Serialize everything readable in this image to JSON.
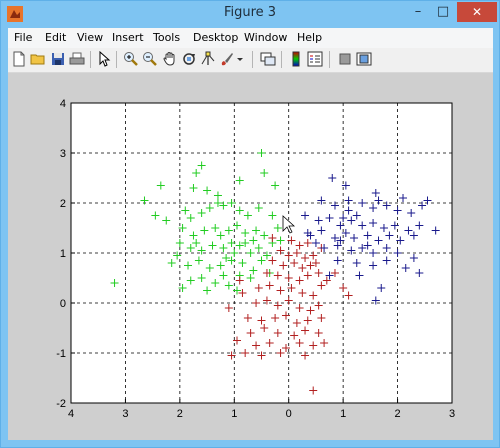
{
  "window": {
    "title": "Figure 3",
    "min_glyph": "–",
    "max_glyph": "□",
    "close_glyph": "✕"
  },
  "menu": [
    "File",
    "Edit",
    "View",
    "Insert",
    "Tools",
    "Desktop",
    "Window",
    "Help"
  ],
  "toolbar": {
    "icons": [
      "new-figure-icon",
      "open-file-icon",
      "save-icon",
      "print-icon",
      "edit-plot-arrow-icon",
      "zoom-in-icon",
      "zoom-out-icon",
      "pan-hand-icon",
      "rotate-3d-icon",
      "data-cursor-icon",
      "brush-icon",
      "brush-dropdown-icon",
      "link-plot-icon",
      "insert-colorbar-icon",
      "insert-legend-icon",
      "hide-plot-tools-icon",
      "show-plot-tools-icon"
    ]
  },
  "chart_data": {
    "type": "scatter",
    "marker": "+",
    "x_range": [
      -4,
      3
    ],
    "y_range": [
      -2,
      4
    ],
    "x_ticks": [
      -4,
      -3,
      -2,
      -1,
      0,
      1,
      2,
      3
    ],
    "x_tick_labels": [
      "4",
      "3",
      "2",
      "1",
      "0",
      "1",
      "2",
      "3"
    ],
    "y_ticks": [
      -2,
      -1,
      0,
      1,
      2,
      3,
      4
    ],
    "y_tick_labels": [
      "-2",
      "-1",
      "0",
      "1",
      "2",
      "3",
      "4"
    ],
    "grid": true,
    "grid_style": "dotted",
    "series": [
      {
        "color": "#22cc22",
        "points": [
          [
            -2.65,
            2.05
          ],
          [
            -2.35,
            2.35
          ],
          [
            -2.25,
            1.65
          ],
          [
            -2.45,
            1.75
          ],
          [
            -3.2,
            0.4
          ],
          [
            -1.7,
            2.6
          ],
          [
            -1.6,
            2.75
          ],
          [
            -1.75,
            2.3
          ],
          [
            -1.5,
            2.25
          ],
          [
            -1.3,
            2.15
          ],
          [
            -1.9,
            1.85
          ],
          [
            -1.8,
            1.7
          ],
          [
            -1.6,
            1.8
          ],
          [
            -1.45,
            1.9
          ],
          [
            -1.2,
            1.95
          ],
          [
            -1.05,
            2.0
          ],
          [
            -0.9,
            1.85
          ],
          [
            -0.75,
            1.75
          ],
          [
            -0.55,
            1.9
          ],
          [
            -0.3,
            1.75
          ],
          [
            -0.2,
            1.5
          ],
          [
            -1.95,
            1.5
          ],
          [
            -1.75,
            1.35
          ],
          [
            -1.55,
            1.45
          ],
          [
            -1.35,
            1.5
          ],
          [
            -1.1,
            1.45
          ],
          [
            -0.95,
            1.55
          ],
          [
            -0.8,
            1.4
          ],
          [
            -0.6,
            1.45
          ],
          [
            -0.45,
            1.35
          ],
          [
            -0.3,
            1.2
          ],
          [
            -0.15,
            1.25
          ],
          [
            -2.0,
            1.2
          ],
          [
            -1.8,
            1.1
          ],
          [
            -1.6,
            1.05
          ],
          [
            -1.4,
            1.15
          ],
          [
            -1.2,
            1.1
          ],
          [
            -1.05,
            1.2
          ],
          [
            -0.9,
            1.15
          ],
          [
            -0.7,
            1.0
          ],
          [
            -0.55,
            1.1
          ],
          [
            -0.4,
            0.95
          ],
          [
            -2.15,
            0.8
          ],
          [
            -1.85,
            0.75
          ],
          [
            -1.65,
            0.85
          ],
          [
            -1.45,
            0.7
          ],
          [
            -1.25,
            0.75
          ],
          [
            -1.05,
            0.85
          ],
          [
            -0.85,
            0.8
          ],
          [
            -0.65,
            0.65
          ],
          [
            -0.5,
            0.85
          ],
          [
            -1.8,
            0.45
          ],
          [
            -1.6,
            0.5
          ],
          [
            -1.35,
            0.4
          ],
          [
            -1.1,
            0.35
          ],
          [
            -0.9,
            0.55
          ],
          [
            -1.95,
            0.3
          ],
          [
            -1.5,
            0.25
          ],
          [
            -1.2,
            0.55
          ],
          [
            -0.95,
            0.25
          ],
          [
            -0.5,
            3.0
          ],
          [
            -0.45,
            2.6
          ],
          [
            -0.9,
            2.45
          ],
          [
            -1.3,
            2.0
          ],
          [
            -0.25,
            2.35
          ],
          [
            -1.7,
            1.2
          ],
          [
            -1.25,
            1.35
          ],
          [
            -0.65,
            1.25
          ],
          [
            -1.0,
            1.0
          ],
          [
            -0.8,
            1.2
          ],
          [
            -2.05,
            0.95
          ],
          [
            -1.15,
            0.9
          ],
          [
            -0.35,
            0.6
          ],
          [
            -0.7,
            0.5
          ]
        ]
      },
      {
        "color": "#b22020",
        "points": [
          [
            0.05,
            1.25
          ],
          [
            0.2,
            1.15
          ],
          [
            0.35,
            1.2
          ],
          [
            -0.15,
            1.05
          ],
          [
            0.0,
            0.95
          ],
          [
            0.15,
            1.0
          ],
          [
            0.3,
            0.9
          ],
          [
            0.45,
            0.95
          ],
          [
            0.6,
            1.1
          ],
          [
            -0.3,
            0.85
          ],
          [
            -0.1,
            0.75
          ],
          [
            0.1,
            0.8
          ],
          [
            0.25,
            0.7
          ],
          [
            0.4,
            0.75
          ],
          [
            0.55,
            0.6
          ],
          [
            -0.4,
            0.6
          ],
          [
            -0.2,
            0.55
          ],
          [
            0.0,
            0.5
          ],
          [
            0.2,
            0.45
          ],
          [
            0.35,
            0.55
          ],
          [
            0.6,
            0.35
          ],
          [
            -0.55,
            0.3
          ],
          [
            -0.35,
            0.35
          ],
          [
            -0.15,
            0.25
          ],
          [
            0.05,
            0.3
          ],
          [
            0.25,
            0.2
          ],
          [
            0.45,
            0.15
          ],
          [
            1.0,
            0.3
          ],
          [
            1.1,
            0.15
          ],
          [
            -0.6,
            0.0
          ],
          [
            -0.4,
            0.05
          ],
          [
            -0.2,
            -0.05
          ],
          [
            0.0,
            0.05
          ],
          [
            0.2,
            -0.1
          ],
          [
            0.4,
            -0.15
          ],
          [
            0.55,
            -0.05
          ],
          [
            -0.75,
            -0.3
          ],
          [
            -0.5,
            -0.35
          ],
          [
            -0.25,
            -0.3
          ],
          [
            -0.05,
            -0.25
          ],
          [
            0.15,
            -0.4
          ],
          [
            0.35,
            -0.35
          ],
          [
            0.6,
            -0.3
          ],
          [
            -0.7,
            -0.6
          ],
          [
            -0.45,
            -0.5
          ],
          [
            -0.2,
            -0.6
          ],
          [
            0.1,
            -0.65
          ],
          [
            0.3,
            -0.55
          ],
          [
            0.55,
            -0.6
          ],
          [
            -0.95,
            -0.75
          ],
          [
            -0.6,
            -0.85
          ],
          [
            -0.35,
            -0.8
          ],
          [
            -0.05,
            -0.9
          ],
          [
            0.2,
            -0.8
          ],
          [
            0.45,
            -0.85
          ],
          [
            0.65,
            -0.8
          ],
          [
            -1.05,
            -1.05
          ],
          [
            -0.8,
            -1.0
          ],
          [
            -0.5,
            -1.05
          ],
          [
            -0.15,
            -1.0
          ],
          [
            0.3,
            -1.05
          ],
          [
            0.45,
            -1.75
          ],
          [
            -0.9,
            0.45
          ],
          [
            -0.85,
            0.2
          ],
          [
            -1.1,
            -0.1
          ],
          [
            -0.3,
            1.3
          ],
          [
            0.85,
            0.6
          ],
          [
            0.7,
            0.45
          ],
          [
            0.5,
            0.8
          ]
        ]
      },
      {
        "color": "#1a1a8c",
        "points": [
          [
            0.8,
            2.5
          ],
          [
            1.05,
            2.35
          ],
          [
            1.6,
            2.2
          ],
          [
            1.65,
            2.05
          ],
          [
            2.1,
            2.1
          ],
          [
            2.55,
            2.05
          ],
          [
            0.6,
            2.05
          ],
          [
            0.85,
            1.95
          ],
          [
            1.1,
            1.85
          ],
          [
            1.35,
            2.0
          ],
          [
            1.55,
            1.9
          ],
          [
            1.8,
            1.95
          ],
          [
            2.0,
            1.85
          ],
          [
            2.25,
            1.8
          ],
          [
            2.45,
            1.95
          ],
          [
            0.3,
            1.75
          ],
          [
            0.55,
            1.65
          ],
          [
            0.75,
            1.7
          ],
          [
            0.95,
            1.55
          ],
          [
            1.15,
            1.65
          ],
          [
            1.35,
            1.55
          ],
          [
            1.55,
            1.6
          ],
          [
            1.75,
            1.5
          ],
          [
            1.95,
            1.55
          ],
          [
            2.2,
            1.45
          ],
          [
            2.4,
            1.55
          ],
          [
            0.4,
            1.35
          ],
          [
            0.6,
            1.45
          ],
          [
            0.85,
            1.3
          ],
          [
            1.05,
            1.4
          ],
          [
            1.2,
            1.3
          ],
          [
            1.45,
            1.35
          ],
          [
            1.65,
            1.25
          ],
          [
            1.85,
            1.35
          ],
          [
            2.05,
            1.25
          ],
          [
            2.3,
            1.35
          ],
          [
            0.65,
            1.1
          ],
          [
            0.9,
            1.15
          ],
          [
            1.15,
            1.05
          ],
          [
            1.35,
            1.1
          ],
          [
            1.55,
            1.0
          ],
          [
            1.8,
            1.1
          ],
          [
            2.0,
            1.0
          ],
          [
            2.3,
            0.9
          ],
          [
            0.9,
            0.85
          ],
          [
            1.25,
            0.8
          ],
          [
            1.55,
            0.75
          ],
          [
            1.8,
            0.85
          ],
          [
            2.15,
            0.7
          ],
          [
            0.75,
            0.55
          ],
          [
            1.3,
            0.55
          ],
          [
            2.4,
            0.6
          ],
          [
            1.7,
            0.3
          ],
          [
            1.6,
            0.05
          ],
          [
            1.0,
            1.7
          ],
          [
            1.25,
            1.75
          ],
          [
            0.5,
            1.2
          ],
          [
            0.95,
            1.25
          ],
          [
            1.45,
            1.15
          ],
          [
            2.7,
            1.45
          ],
          [
            1.1,
            2.05
          ],
          [
            0.35,
            1.4
          ]
        ]
      }
    ]
  }
}
